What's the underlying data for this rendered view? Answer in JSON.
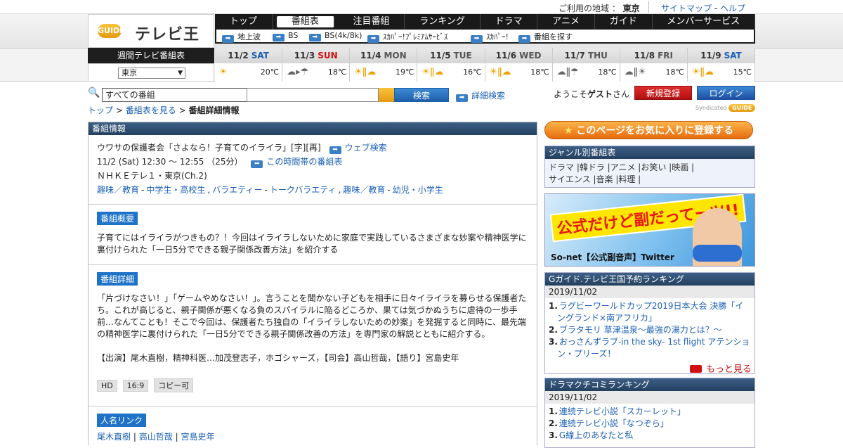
{
  "util": {
    "area_label": "ご利用の地域 ：",
    "area": "東京",
    "sitemap": "サイトマップ",
    "dash": "-",
    "help": "ヘルプ"
  },
  "logo": {
    "mark": "GUIDE",
    "title": "テレビ王国"
  },
  "nav": [
    "トップ",
    "番組表",
    "注目番組",
    "ランキング",
    "ドラマ",
    "アニメ",
    "ガイド",
    "メンバーサービス"
  ],
  "subnav": [
    "地上波",
    "BS",
    "BS(4k/8k)",
    "ｽｶﾊﾟｰ!ﾌﾟﾚﾐｱﾑｻｰﾋﾞｽ",
    "ｽｶﾊﾟｰ!",
    "番組を探す"
  ],
  "weekly": {
    "label": "週間テレビ番組表",
    "region": "東京"
  },
  "days": [
    {
      "date": "11/2",
      "wd": "SAT",
      "kind": "sat",
      "icon": "☀",
      "iconClass": "sunny",
      "temp": "20℃"
    },
    {
      "date": "11/3",
      "wd": "SUN",
      "kind": "sun",
      "icon": "☁▸☂",
      "iconClass": "cloud",
      "temp": "18℃"
    },
    {
      "date": "11/4",
      "wd": "MON",
      "kind": "wd",
      "icon": "☀ǁ☁",
      "iconClass": "sunny",
      "temp": "19℃"
    },
    {
      "date": "11/5",
      "wd": "TUE",
      "kind": "wd",
      "icon": "☀ǁ☁",
      "iconClass": "sunny",
      "temp": "16℃"
    },
    {
      "date": "11/6",
      "wd": "WED",
      "kind": "wd",
      "icon": "☀ǁ☁",
      "iconClass": "sunny",
      "temp": "18℃"
    },
    {
      "date": "11/7",
      "wd": "THU",
      "kind": "wd",
      "icon": "☁ǁ☂",
      "iconClass": "cloud",
      "temp": "18℃"
    },
    {
      "date": "11/8",
      "wd": "FRI",
      "kind": "wd",
      "icon": "☁ǁ☀",
      "iconClass": "cloud",
      "temp": "18℃"
    },
    {
      "date": "11/9",
      "wd": "SAT",
      "kind": "sat",
      "icon": "☀ǁ☁",
      "iconClass": "sunny",
      "temp": "15℃"
    }
  ],
  "search": {
    "category": "すべての番組",
    "button": "検索",
    "advanced": "詳細検索"
  },
  "account": {
    "welcome_pre": "ようこそ",
    "guest": "ゲスト",
    "welcome_post": "さん",
    "register": "新規登録",
    "login": "ログイン",
    "synd": "Syndicated",
    "synd_mark": "GUIDE"
  },
  "breadcrumb": {
    "top": "トップ",
    "sep": ">",
    "schedule": "番組表を見る",
    "current": "番組詳細情報"
  },
  "program": {
    "panel_title": "番組情報",
    "title": "ウワサの保護者会「さよなら！子育てのイライラ」[字][再]",
    "web_search": "ウェブ検索",
    "time": "11/2 (Sat) 12:30 ～ 12:55 （25分）",
    "time_link": "この時間帯の番組表",
    "channel": "ＮＨＫＥテレ１・東京(Ch.2)",
    "genres": [
      "趣味／教育",
      "-",
      "中学生・高校生",
      ",",
      "バラエティー",
      "-",
      "トークバラエティ",
      ",",
      "趣味／教育",
      "-",
      "幼児・小学生"
    ],
    "summary_label": "番組概要",
    "summary": "子育てにはイライラがつきもの？！今回はイライラしないために家庭で実践しているさまざまな妙案や精神医学に裏付けられた「一日5分でできる親子関係改善方法」を紹介する",
    "detail_label": "番組詳細",
    "detail": "「片づけなさい！」「ゲームやめなさい！」。言うことを聞かない子どもを相手に日々イライラを募らせる保護者たち。これが高じると、親子関係が悪くなる負のスパイラルに陥るどころか、果ては気づかぬうちに虐待の一歩手前…なんてことも！そこで今回は、保護者たち独自の「イライラしないための妙案」を発掘すると同時に、最先端の精神医学に裏付けられた「一日5分でできる親子関係改善の方法」を専門家の解説とともに紹介する。",
    "cast": "【出演】尾木直樹，精神科医…加茂登志子，ホゴシャーズ，【司会】高山哲哉，【語り】宮島史年",
    "tags": [
      "HD",
      "16:9",
      "コピー可"
    ],
    "people_label": "人名リンク",
    "people": [
      "尾木直樹",
      "|",
      "高山哲哉",
      "|",
      "宮島史年"
    ]
  },
  "sidebar": {
    "favorite": "このページをお気に入りに登録する",
    "genre_title": "ジャンル別番組表",
    "genre_line1": "ドラマ |韓ドラ |アニメ |お笑い |映画 |",
    "genre_line2": "サイエンス |音楽 |料理 |",
    "banner_title": "公式だけど副だってーツ!!",
    "banner_sub": "So-net【公式副音声】Twitter",
    "rank1": {
      "title": "Gガイド.テレビ王国予約ランキング",
      "date": "2019/11/02",
      "items": [
        {
          "n": "1.",
          "t": "ラグビーワールドカップ2019日本大会 決勝「イングランド×南アフリカ」"
        },
        {
          "n": "2.",
          "t": "ブラタモリ 草津温泉〜最強の湯力とは？〜"
        },
        {
          "n": "3.",
          "t": "おっさんずラブ-in the sky- 1st flight アテンション・プリーズ！"
        }
      ],
      "more": "もっと見る"
    },
    "rank2": {
      "title": "ドラマクチコミランキング",
      "date": "2019/11/02",
      "items": [
        {
          "n": "1.",
          "t": "連続テレビ小説「スカーレット」"
        },
        {
          "n": "2.",
          "t": "連続テレビ小説「なつぞら」"
        },
        {
          "n": "3.",
          "t": "G線上のあなたと私"
        }
      ]
    }
  }
}
